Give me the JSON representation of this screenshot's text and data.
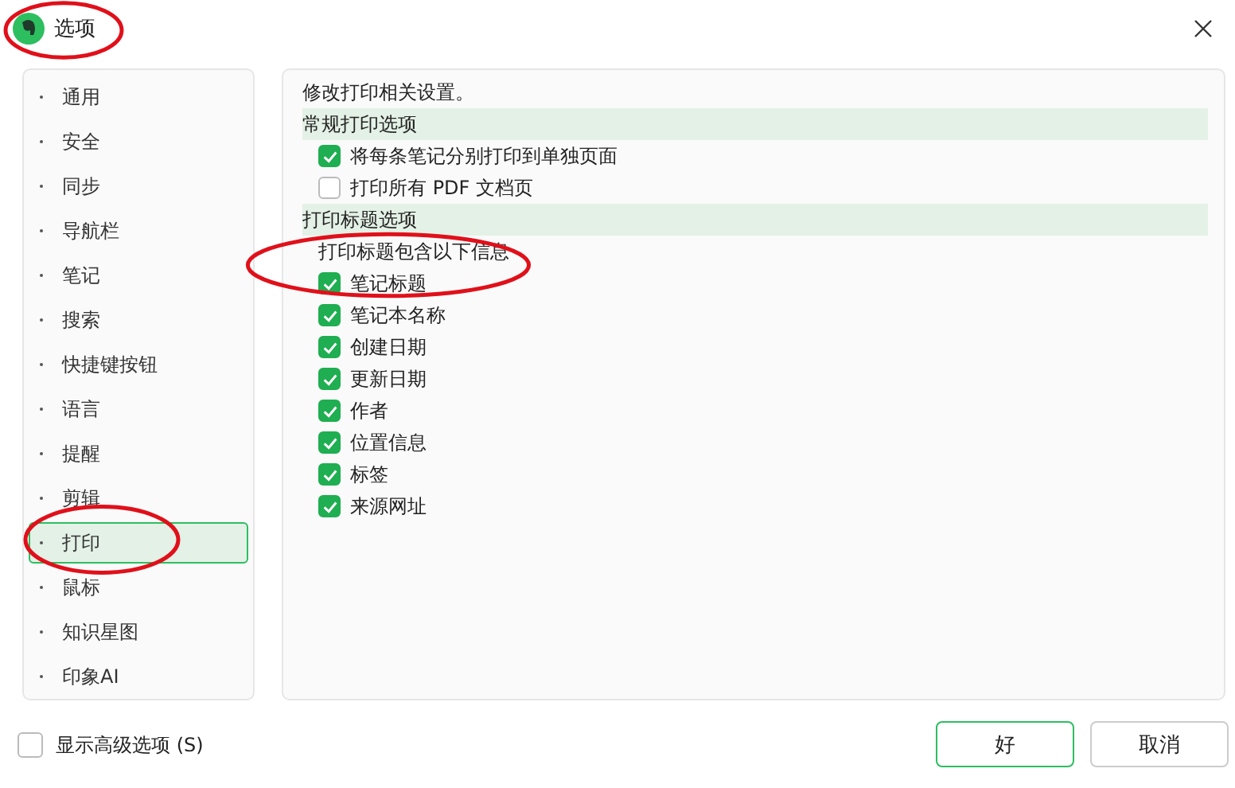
{
  "window": {
    "title": "选项",
    "circled": true
  },
  "sidebar": {
    "items": [
      {
        "label": "通用",
        "selected": false,
        "circled": false
      },
      {
        "label": "安全",
        "selected": false,
        "circled": false
      },
      {
        "label": "同步",
        "selected": false,
        "circled": false
      },
      {
        "label": "导航栏",
        "selected": false,
        "circled": false
      },
      {
        "label": "笔记",
        "selected": false,
        "circled": false
      },
      {
        "label": "搜索",
        "selected": false,
        "circled": false
      },
      {
        "label": "快捷键按钮",
        "selected": false,
        "circled": false
      },
      {
        "label": "语言",
        "selected": false,
        "circled": false
      },
      {
        "label": "提醒",
        "selected": false,
        "circled": false
      },
      {
        "label": "剪辑",
        "selected": false,
        "circled": false
      },
      {
        "label": "打印",
        "selected": true,
        "circled": true
      },
      {
        "label": "鼠标",
        "selected": false,
        "circled": false
      },
      {
        "label": "知识星图",
        "selected": false,
        "circled": false
      },
      {
        "label": "印象AI",
        "selected": false,
        "circled": false
      }
    ]
  },
  "panel": {
    "description": "修改打印相关设置。",
    "sections": [
      {
        "heading": "常规打印选项",
        "options": [
          {
            "label": "将每条笔记分别打印到单独页面",
            "checked": true,
            "circled": false
          },
          {
            "label": "打印所有 PDF 文档页",
            "checked": false,
            "circled": false
          }
        ]
      },
      {
        "heading": "打印标题选项",
        "sublabel": "打印标题包含以下信息",
        "options": [
          {
            "label": "笔记标题",
            "checked": true,
            "circled": true
          },
          {
            "label": "笔记本名称",
            "checked": true,
            "circled": false
          },
          {
            "label": "创建日期",
            "checked": true,
            "circled": false
          },
          {
            "label": "更新日期",
            "checked": true,
            "circled": false
          },
          {
            "label": "作者",
            "checked": true,
            "circled": false
          },
          {
            "label": "位置信息",
            "checked": true,
            "circled": false
          },
          {
            "label": "标签",
            "checked": true,
            "circled": false
          },
          {
            "label": "来源网址",
            "checked": true,
            "circled": false
          }
        ]
      }
    ]
  },
  "footer": {
    "advanced": {
      "label": "显示高级选项 (S)",
      "checked": false
    },
    "buttons": [
      {
        "label": "好",
        "kind": "primary"
      },
      {
        "label": "取消",
        "kind": "secondary"
      }
    ]
  }
}
